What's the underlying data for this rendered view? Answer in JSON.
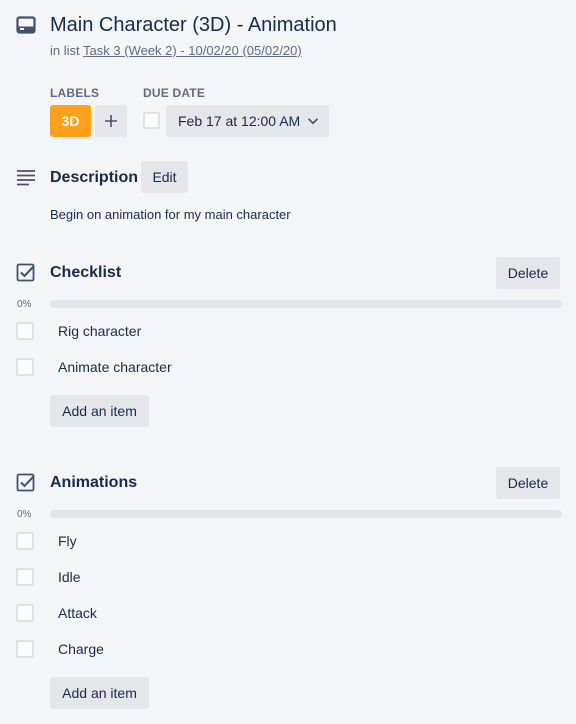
{
  "card": {
    "title": "Main Character (3D) - Animation",
    "in_list_prefix": "in list",
    "list_name": "Task 3 (Week 2) - 10/02/20 (05/02/20)"
  },
  "labels": {
    "heading": "LABELS",
    "items": [
      {
        "text": "3D",
        "color": "#ff9f1a"
      }
    ],
    "add_symbol": "+"
  },
  "due_date": {
    "heading": "DUE DATE",
    "value": "Feb 17 at 12:00 AM",
    "complete": false
  },
  "description": {
    "title": "Description",
    "edit_label": "Edit",
    "text": "Begin on animation for my main character"
  },
  "checklists": [
    {
      "title": "Checklist",
      "delete_label": "Delete",
      "percent": "0%",
      "progress": 0,
      "items": [
        {
          "label": "Rig character",
          "checked": false
        },
        {
          "label": "Animate character",
          "checked": false
        }
      ],
      "add_label": "Add an item"
    },
    {
      "title": "Animations",
      "delete_label": "Delete",
      "percent": "0%",
      "progress": 0,
      "items": [
        {
          "label": "Fly",
          "checked": false
        },
        {
          "label": "Idle",
          "checked": false
        },
        {
          "label": "Attack",
          "checked": false
        },
        {
          "label": "Charge",
          "checked": false
        }
      ],
      "add_label": "Add an item"
    }
  ],
  "colors": {
    "background": "#f4f5f7",
    "text": "#172b4d",
    "muted": "#5e6c84",
    "button": "#e4e6ea",
    "label_orange": "#ff9f1a"
  },
  "icons": {
    "title": "card-icon",
    "description": "description-lines-icon",
    "checklist": "checkbox-checked-icon",
    "add_label": "plus-icon",
    "due_dropdown": "chevron-down-icon"
  }
}
